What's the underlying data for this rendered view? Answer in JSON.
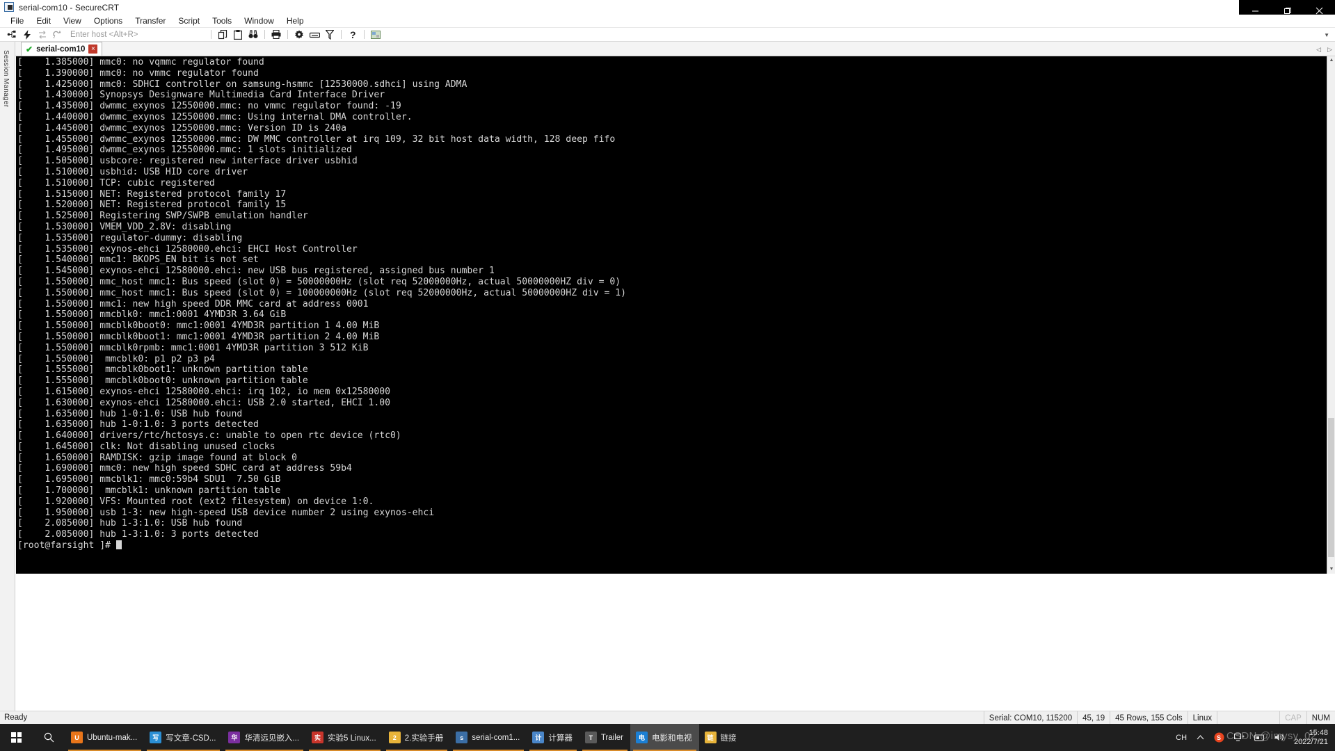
{
  "window": {
    "title": "serial-com10 - SecureCRT",
    "icon": "securecrt-app-icon",
    "controls": {
      "minimize": "minimize-icon",
      "maximize": "maximize-icon",
      "close": "close-icon"
    }
  },
  "menubar": {
    "items": [
      "File",
      "Edit",
      "View",
      "Options",
      "Transfer",
      "Script",
      "Tools",
      "Window",
      "Help"
    ]
  },
  "toolbar": {
    "host_placeholder": "Enter host <Alt+R>",
    "icons_left": [
      "connect-icon",
      "quick-connect-icon",
      "reconnect-icon",
      "connect-local-shell-icon"
    ],
    "icons_right": [
      "copy-icon",
      "paste-icon",
      "find-icon",
      "print-icon",
      "settings-icon",
      "keymap-icon",
      "filter-icon",
      "help-icon",
      "session-options-icon"
    ],
    "caret": "chevron-down-icon"
  },
  "sidebar": {
    "label": "Session Manager"
  },
  "tabs": [
    {
      "label": "serial-com10",
      "status_icon": "connected-check-icon",
      "close_icon": "close-tab-icon",
      "active": true
    }
  ],
  "tabstrip_nav": {
    "prev": "scroll-left-icon",
    "next": "scroll-right-icon"
  },
  "terminal": {
    "prompt": "[root@farsight ]# ",
    "lines": [
      "[    1.385000] mmc0: no vqmmc regulator found",
      "[    1.390000] mmc0: no vmmc regulator found",
      "[    1.425000] mmc0: SDHCI controller on samsung-hsmmc [12530000.sdhci] using ADMA",
      "[    1.430000] Synopsys Designware Multimedia Card Interface Driver",
      "[    1.435000] dwmmc_exynos 12550000.mmc: no vmmc regulator found: -19",
      "[    1.440000] dwmmc_exynos 12550000.mmc: Using internal DMA controller.",
      "[    1.445000] dwmmc_exynos 12550000.mmc: Version ID is 240a",
      "[    1.455000] dwmmc_exynos 12550000.mmc: DW MMC controller at irq 109, 32 bit host data width, 128 deep fifo",
      "[    1.495000] dwmmc_exynos 12550000.mmc: 1 slots initialized",
      "[    1.505000] usbcore: registered new interface driver usbhid",
      "[    1.510000] usbhid: USB HID core driver",
      "[    1.510000] TCP: cubic registered",
      "[    1.515000] NET: Registered protocol family 17",
      "[    1.520000] NET: Registered protocol family 15",
      "[    1.525000] Registering SWP/SWPB emulation handler",
      "[    1.530000] VMEM_VDD_2.8V: disabling",
      "[    1.535000] regulator-dummy: disabling",
      "[    1.535000] exynos-ehci 12580000.ehci: EHCI Host Controller",
      "[    1.540000] mmc1: BKOPS_EN bit is not set",
      "[    1.545000] exynos-ehci 12580000.ehci: new USB bus registered, assigned bus number 1",
      "[    1.550000] mmc_host mmc1: Bus speed (slot 0) = 50000000Hz (slot req 52000000Hz, actual 50000000HZ div = 0)",
      "[    1.550000] mmc_host mmc1: Bus speed (slot 0) = 100000000Hz (slot req 52000000Hz, actual 50000000HZ div = 1)",
      "[    1.550000] mmc1: new high speed DDR MMC card at address 0001",
      "[    1.550000] mmcblk0: mmc1:0001 4YMD3R 3.64 GiB",
      "[    1.550000] mmcblk0boot0: mmc1:0001 4YMD3R partition 1 4.00 MiB",
      "[    1.550000] mmcblk0boot1: mmc1:0001 4YMD3R partition 2 4.00 MiB",
      "[    1.550000] mmcblk0rpmb: mmc1:0001 4YMD3R partition 3 512 KiB",
      "[    1.550000]  mmcblk0: p1 p2 p3 p4",
      "[    1.555000]  mmcblk0boot1: unknown partition table",
      "[    1.555000]  mmcblk0boot0: unknown partition table",
      "[    1.615000] exynos-ehci 12580000.ehci: irq 102, io mem 0x12580000",
      "[    1.630000] exynos-ehci 12580000.ehci: USB 2.0 started, EHCI 1.00",
      "[    1.635000] hub 1-0:1.0: USB hub found",
      "[    1.635000] hub 1-0:1.0: 3 ports detected",
      "[    1.640000] drivers/rtc/hctosys.c: unable to open rtc device (rtc0)",
      "[    1.645000] clk: Not disabling unused clocks",
      "[    1.650000] RAMDISK: gzip image found at block 0",
      "[    1.690000] mmc0: new high speed SDHC card at address 59b4",
      "[    1.695000] mmcblk1: mmc0:59b4 SDU1  7.50 GiB",
      "[    1.700000]  mmcblk1: unknown partition table",
      "[    1.920000] VFS: Mounted root (ext2 filesystem) on device 1:0.",
      "[    1.950000] usb 1-3: new high-speed USB device number 2 using exynos-ehci",
      "[    2.085000] hub 1-3:1.0: USB hub found",
      "[    2.085000] hub 1-3:1.0: 3 ports detected"
    ],
    "colors": {
      "background": "#000000",
      "foreground": "#d6d6d6"
    }
  },
  "statusbar": {
    "ready": "Ready",
    "serial": "Serial: COM10, 115200",
    "cursor": "45,  19",
    "size": "45 Rows, 155 Cols",
    "emulation": "Linux",
    "cap": "CAP",
    "num": "NUM"
  },
  "taskbar": {
    "start_icon": "windows-start-icon",
    "search_icon": "search-icon",
    "items": [
      {
        "label": "Ubuntu-mak...",
        "icon": "virtualbox-icon",
        "color": "#e8751a",
        "active": false,
        "running": true
      },
      {
        "label": "写文章-CSD...",
        "icon": "edge-browser-icon",
        "color": "#2b8fd4",
        "active": false,
        "running": true
      },
      {
        "label": "华清远见嵌入...",
        "icon": "onenote-icon",
        "color": "#7b2fa0",
        "active": false,
        "running": true
      },
      {
        "label": "实验5 Linux...",
        "icon": "pdf-icon",
        "color": "#c8352b",
        "active": false,
        "running": true
      },
      {
        "label": "2.实验手册",
        "icon": "folder-icon",
        "color": "#e8b43a",
        "active": false,
        "running": true
      },
      {
        "label": "serial-com1...",
        "icon": "securecrt-icon",
        "color": "#3b6ea5",
        "active": false,
        "running": true
      },
      {
        "label": "计算器",
        "icon": "calculator-icon",
        "color": "#4a86c8",
        "active": false,
        "running": true
      },
      {
        "label": "Trailer",
        "icon": "trailer-icon",
        "color": "#5a5a5a",
        "active": false,
        "running": true
      },
      {
        "label": "电影和电视",
        "icon": "movies-tv-icon",
        "color": "#1b7fd4",
        "active": true,
        "running": true
      },
      {
        "label": "链接",
        "icon": "links-icon",
        "color": "#e8b43a",
        "active": false,
        "running": false
      }
    ],
    "tray": {
      "ime": "CH",
      "chevron": "show-hidden-icons-icon",
      "icons": [
        "sogou-icon",
        "network-icon",
        "onedrive-icon",
        "volume-icon"
      ],
      "time": "15:48",
      "date": "2022/7/21"
    }
  },
  "watermark": "CSDN @imysy_02_"
}
